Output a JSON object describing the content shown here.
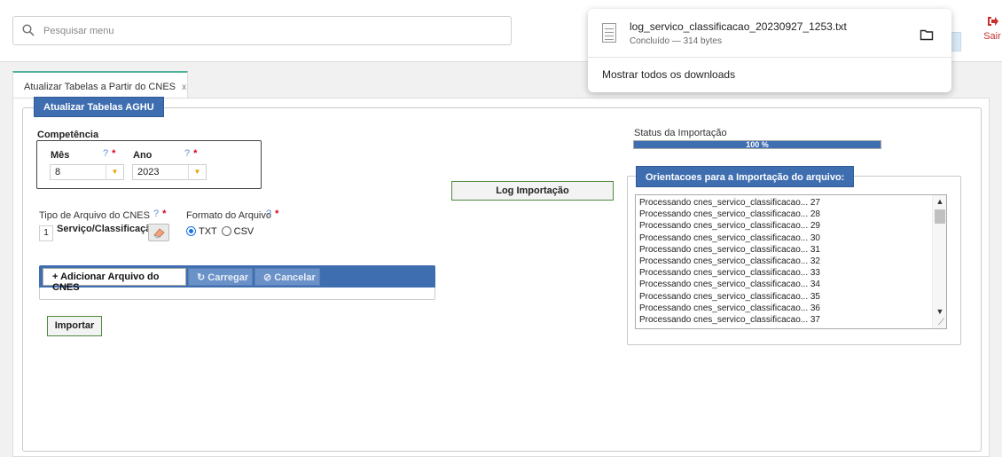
{
  "search": {
    "placeholder": "Pesquisar menu"
  },
  "header": {
    "exit_label": "Sair"
  },
  "download": {
    "filename": "log_servico_classificacao_20230927_1253.txt",
    "status": "Concluído — 314 bytes",
    "show_all": "Mostrar todos os downloads"
  },
  "tab": {
    "label": "Atualizar Tabelas a Partir do CNES",
    "close": "x"
  },
  "form": {
    "legend": "Atualizar Tabelas AGHU",
    "competencia_label": "Competência",
    "mes_label": "Mês",
    "mes_value": "8",
    "ano_label": "Ano",
    "ano_value": "2023",
    "help": "?",
    "required": "*",
    "tipo_label": "Tipo de Arquivo do CNES",
    "tipo_code": "1",
    "tipo_value": "Serviço/Classificação",
    "formato_label": "Formato do Arquivo",
    "format_txt": "TXT",
    "format_csv": "CSV",
    "selected_format": "TXT",
    "btn_add": "+ Adicionar Arquivo do CNES",
    "btn_carregar": "↻ Carregar",
    "btn_cancelar": "⊘ Cancelar",
    "btn_importar": "Importar",
    "btn_log": "Log Importação"
  },
  "status": {
    "label": "Status da Importação",
    "progress_percent": 100,
    "progress_text": "100 %"
  },
  "orientacoes": {
    "legend": "Orientacoes para a Importação do arquivo:",
    "lines": [
      "Processando cnes_servico_classificacao... 27",
      "Processando cnes_servico_classificacao... 28",
      "Processando cnes_servico_classificacao... 29",
      "Processando cnes_servico_classificacao... 30",
      "Processando cnes_servico_classificacao... 31",
      "Processando cnes_servico_classificacao... 32",
      "Processando cnes_servico_classificacao... 33",
      "Processando cnes_servico_classificacao... 34",
      "Processando cnes_servico_classificacao... 35",
      "Processando cnes_servico_classificacao... 36",
      "Processando cnes_servico_classificacao... 37"
    ]
  },
  "colors": {
    "primary": "#3f6eb0",
    "accent": "#4fb39c",
    "required": "#d9001b",
    "exit": "#c9302c"
  }
}
